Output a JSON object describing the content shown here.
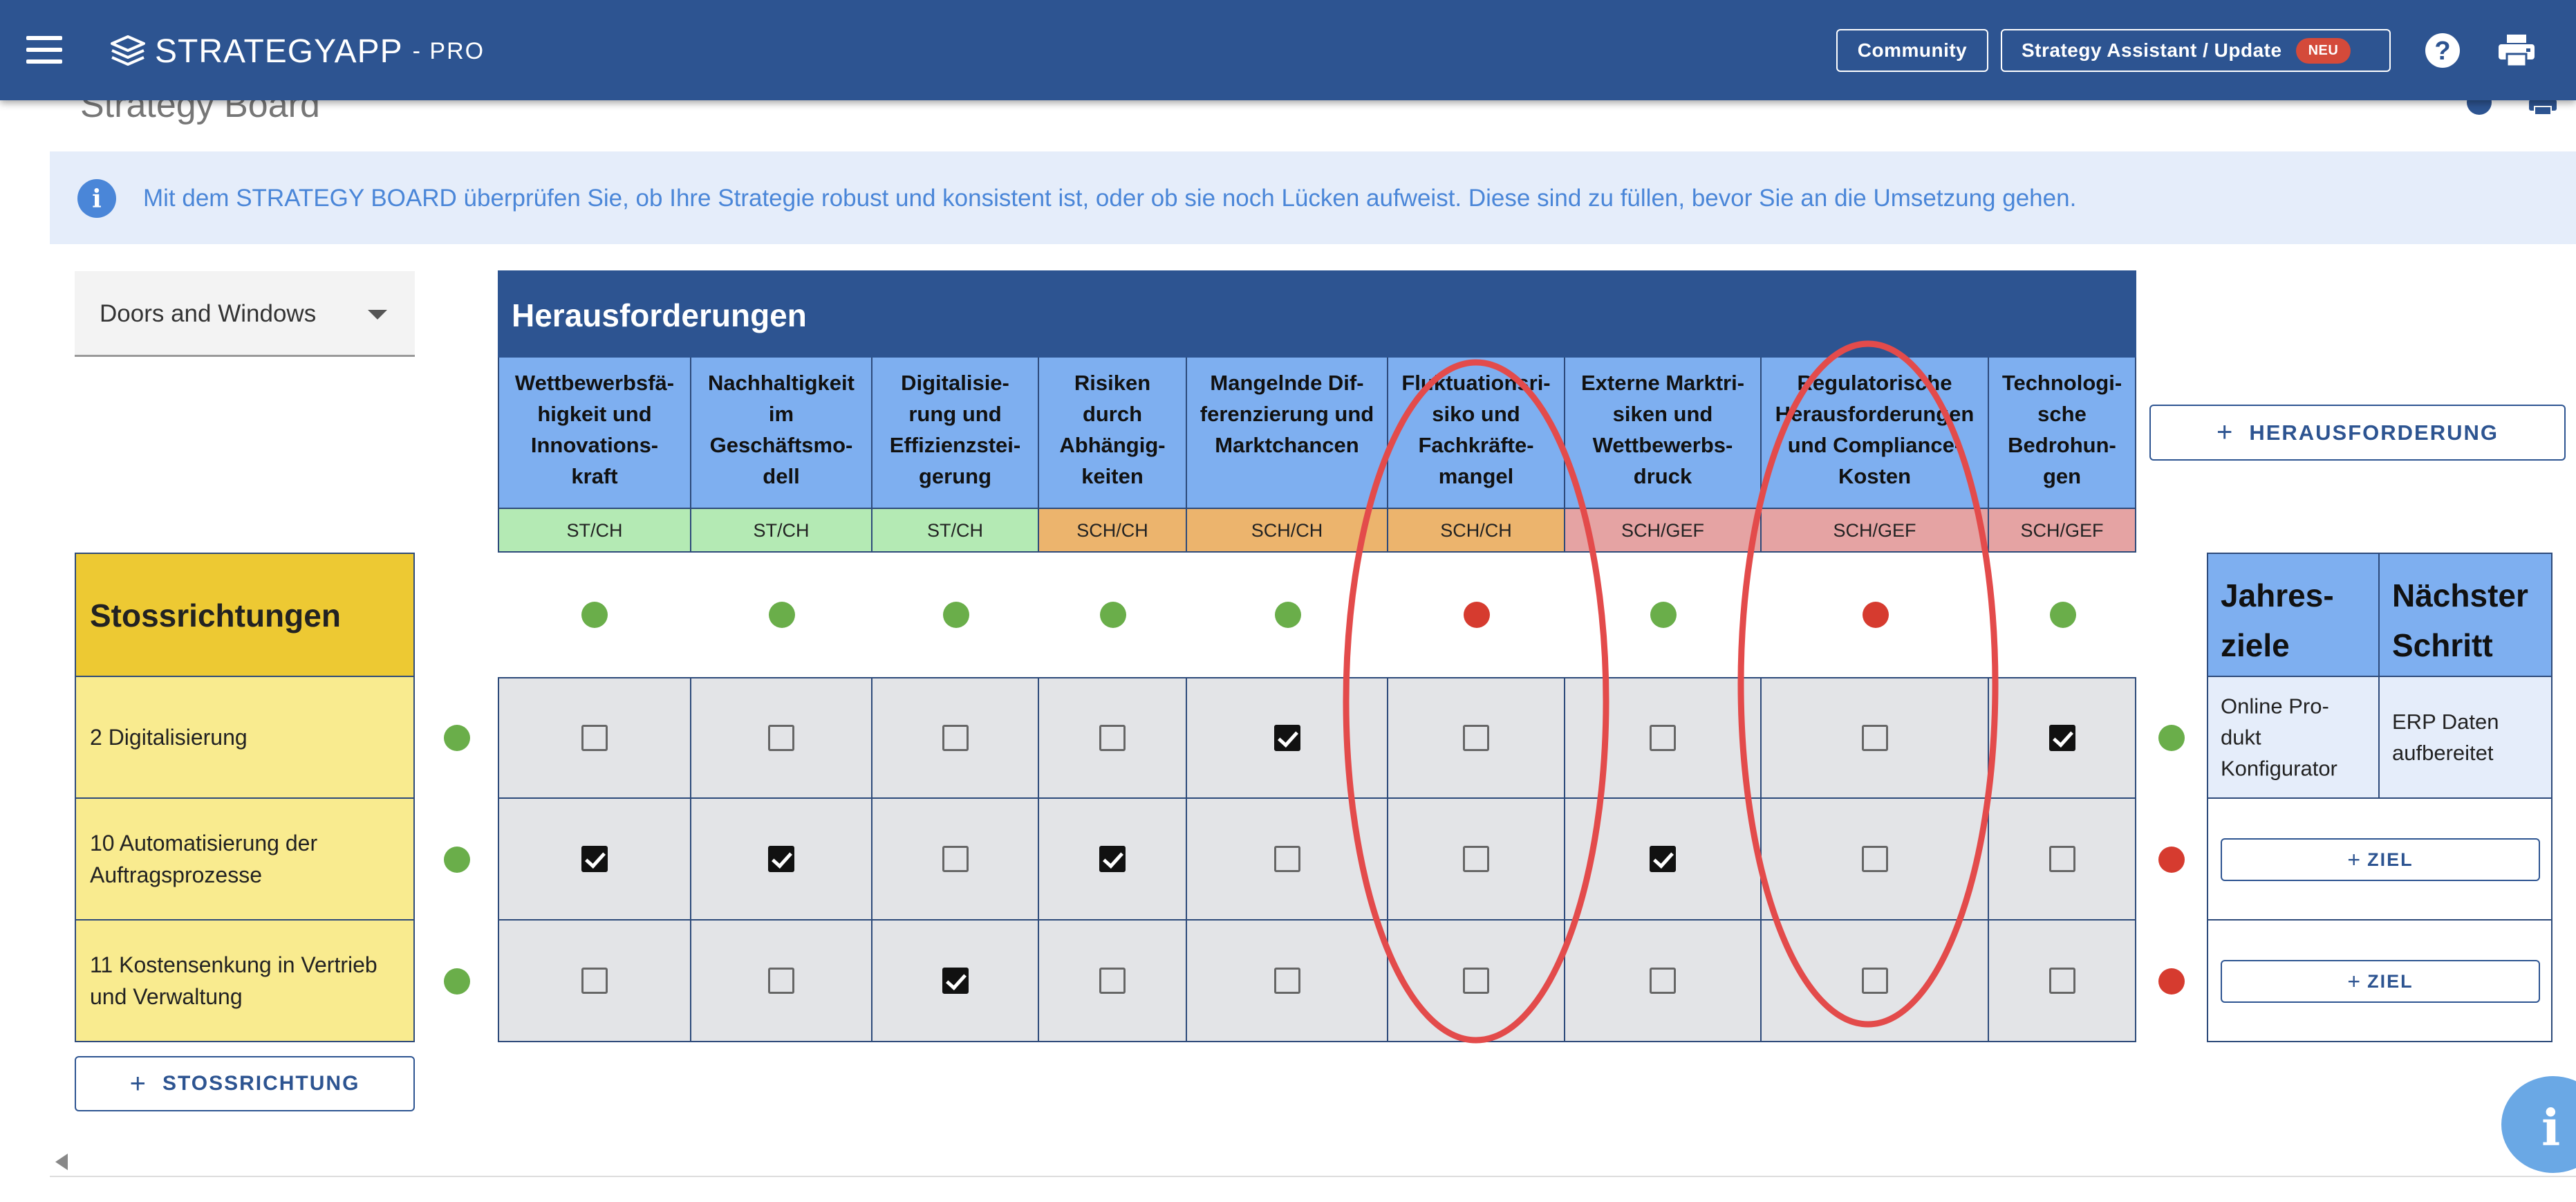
{
  "app": {
    "brand": "STRATEGYAPP",
    "edition": "- PRO",
    "community_label": "Community",
    "assistant_label": "Strategy Assistant / Update",
    "neu_badge": "NEU",
    "help_glyph": "?",
    "colors": {
      "topbar": "#2d5491",
      "accent": "#4a86d8",
      "green": "#6aae4a",
      "red": "#d63b2f",
      "yellow": "#edc933"
    },
    "icons": [
      "menu-icon",
      "logo-icon",
      "help-icon",
      "print-icon",
      "info-icon",
      "dropdown-caret-icon",
      "plus-icon",
      "scroll-left-icon"
    ]
  },
  "page": {
    "title": "Strategy Board",
    "info_glyph": "i",
    "info_text": "Mit dem STRATEGY BOARD überprüfen Sie, ob Ihre Strategie robust und konsistent ist, oder ob sie noch Lücken aufweist. Diese sind zu füllen, bevor Sie an die Umsetzung gehen."
  },
  "selector": {
    "value": "Doors and Windows"
  },
  "challenges": {
    "title": "Herausforderungen",
    "columns": [
      {
        "label": "Wettbewerbsfä-\nhigkeit und\nInnovations-\nkraft",
        "tag": "ST/CH",
        "tag_color": "green",
        "status": "green"
      },
      {
        "label": "Nachhaltigkeit\nim\nGeschäftsmo-\ndell",
        "tag": "ST/CH",
        "tag_color": "green",
        "status": "green"
      },
      {
        "label": "Digitalisie-\nrung und\nEffizienzstei-\ngerung",
        "tag": "ST/CH",
        "tag_color": "green",
        "status": "green"
      },
      {
        "label": "Risiken\ndurch\nAbhängig-\nkeiten",
        "tag": "SCH/CH",
        "tag_color": "orange",
        "status": "green"
      },
      {
        "label": "Mangelnde Dif-\nferenzierung und\nMarktchancen",
        "tag": "SCH/CH",
        "tag_color": "orange",
        "status": "green"
      },
      {
        "label": "Fluktuationsri-\nsiko und\nFachkräfte-\nmangel",
        "tag": "SCH/CH",
        "tag_color": "orange",
        "status": "red"
      },
      {
        "label": "Externe Marktri-\nsiken und\nWettbewerbs-\ndruck",
        "tag": "SCH/GEF",
        "tag_color": "pink",
        "status": "green"
      },
      {
        "label": "Regulatorische\nHerausforderungen\nund Compliance-\nKosten",
        "tag": "SCH/GEF",
        "tag_color": "pink",
        "status": "red"
      },
      {
        "label": "Technologi-\nsche\nBedrohun-\ngen",
        "tag": "SCH/GEF",
        "tag_color": "pink",
        "status": "green"
      }
    ],
    "add_label": "HERAUSFORDERUNG"
  },
  "thrusts": {
    "title": "Stossrichtungen",
    "rows": [
      {
        "label": "2 Digitalisierung",
        "left_status": "green",
        "right_status": "green",
        "checks": [
          false,
          false,
          false,
          false,
          true,
          false,
          false,
          false,
          true
        ]
      },
      {
        "label": "10 Automatisierung der Auftragsprozesse",
        "left_status": "green",
        "right_status": "red",
        "checks": [
          true,
          true,
          false,
          true,
          false,
          false,
          true,
          false,
          false
        ]
      },
      {
        "label": "11 Kostensenkung in Vertrieb und Verwaltung",
        "left_status": "green",
        "right_status": "red",
        "checks": [
          false,
          false,
          true,
          false,
          false,
          false,
          false,
          false,
          false
        ]
      }
    ],
    "add_label": "STOSSRICHTUNG"
  },
  "goals": {
    "annual_title": "Jahres-\nziele",
    "next_title": "Nächster\nSchritt",
    "rows": [
      {
        "annual": "Online Pro-\ndukt\nKonfigurator",
        "next": "ERP Daten\naufbereitet"
      }
    ],
    "add_goal_label": "ZIEL"
  },
  "fab_glyph": "i"
}
